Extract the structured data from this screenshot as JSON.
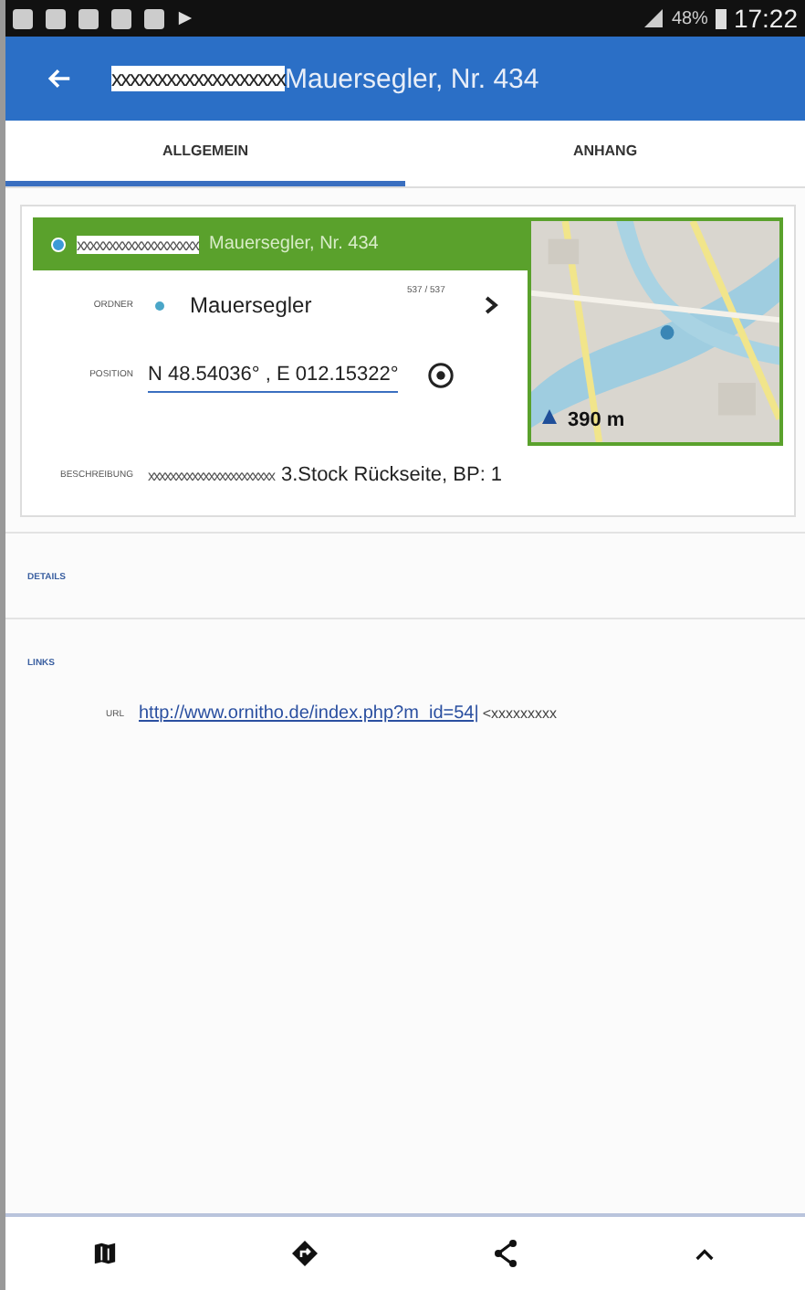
{
  "status_bar": {
    "battery": "48%",
    "time": "17:22"
  },
  "app_bar": {
    "title_redacted": "xxxxxxxxxxxxxxxxxxx",
    "title": "Mauersegler, Nr. 434"
  },
  "tabs": [
    {
      "label": "ALLGEMEIN",
      "selected": true
    },
    {
      "label": "ANHANG",
      "selected": false
    }
  ],
  "header": {
    "redacted": "xxxxxxxxxxxxxxxxxxx",
    "title": "Mauersegler, Nr. 434"
  },
  "folder": {
    "label": "ORDNER",
    "value": "Mauersegler",
    "count": "537 / 537"
  },
  "position": {
    "label": "POSITION",
    "value": "N 48.54036° , E 012.15322°"
  },
  "description": {
    "label": "BESCHREIBUNG",
    "redacted": "xxxxxxxxxxxxxxxxxxxxxxx",
    "value": "3.Stock Rückseite, BP: 1"
  },
  "map": {
    "distance": "390 m"
  },
  "sections": [
    {
      "title": "DETAILS"
    },
    {
      "title": "LINKS"
    }
  ],
  "links": [
    {
      "label": "URL",
      "url": "http://www.ornitho.de/index.php?m_id=54|",
      "suffix": "<xxxxxxxxx"
    }
  ],
  "bottom_nav": [
    {
      "kind": "map"
    },
    {
      "kind": "directions"
    },
    {
      "kind": "share"
    },
    {
      "kind": "up"
    }
  ]
}
